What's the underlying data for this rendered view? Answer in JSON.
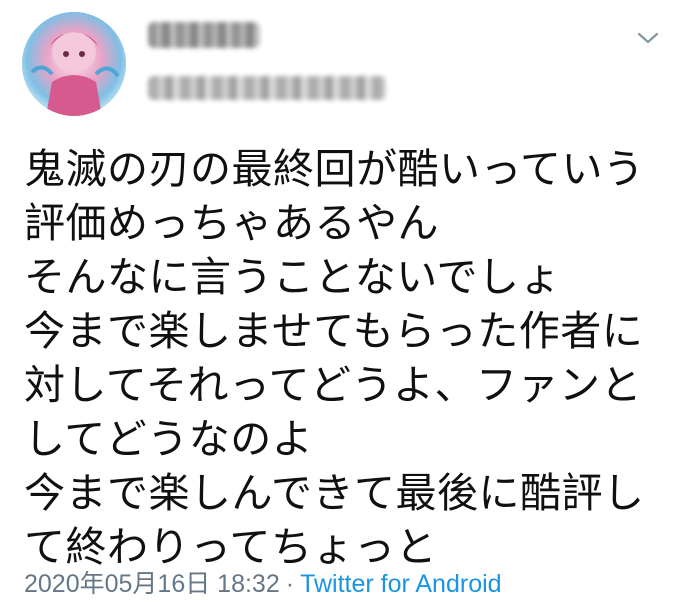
{
  "tweet": {
    "lines": [
      "鬼滅の刃の最終回が酷いっていう",
      "評価めっちゃあるやん",
      "そんなに言うことないでしょ",
      "今まで楽しませてもらった作者に",
      "対してそれってどうよ、ファンと",
      "してどうなのよ",
      "今まで楽しんできて最後に酷評し",
      "て終わりってちょっと"
    ],
    "timestamp": "2020年05月16日 18:32",
    "separator": "·",
    "source": "Twitter for Android"
  },
  "icons": {
    "menu": "chevron-down-icon"
  },
  "colors": {
    "text": "#101010",
    "meta": "#657786",
    "link": "#1b95e0"
  }
}
